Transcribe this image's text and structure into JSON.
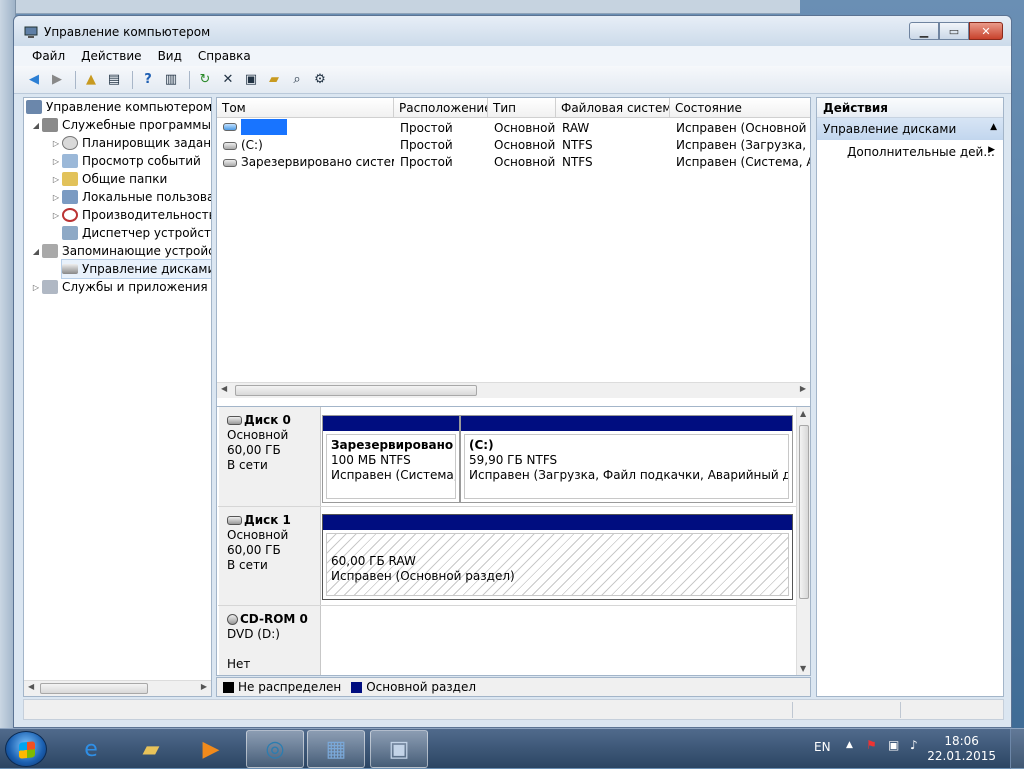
{
  "window": {
    "title": "Управление компьютером"
  },
  "menu": [
    "Файл",
    "Действие",
    "Вид",
    "Справка"
  ],
  "tree": {
    "root": "Управление компьютером (л",
    "system_tools": "Служебные программы",
    "scheduler": "Планировщик заданий",
    "events": "Просмотр событий",
    "shared": "Общие папки",
    "local_users": "Локальные пользовате",
    "performance": "Производительность",
    "devices": "Диспетчер устройств",
    "storage": "Запоминающие устройств",
    "disk_mgmt": "Управление дисками",
    "services": "Службы и приложения"
  },
  "volumes": {
    "headers": [
      "Том",
      "Расположение",
      "Тип",
      "Файловая система",
      "Состояние"
    ],
    "rows": [
      {
        "name": "",
        "layout": "Простой",
        "type": "Основной",
        "fs": "RAW",
        "status": "Исправен (Основной раз"
      },
      {
        "name": "(C:)",
        "layout": "Простой",
        "type": "Основной",
        "fs": "NTFS",
        "status": "Исправен (Загрузка, Фай"
      },
      {
        "name": "Зарезервировано системой",
        "layout": "Простой",
        "type": "Основной",
        "fs": "NTFS",
        "status": "Исправен (Система, Акти"
      }
    ]
  },
  "disks": {
    "disk0": {
      "name": "Диск 0",
      "type": "Основной",
      "size": "60,00 ГБ",
      "state": "В сети",
      "p1": {
        "title": "Зарезервировано си",
        "line2": "100 МБ NTFS",
        "line3": "Исправен (Система, А"
      },
      "p2": {
        "title": "(C:)",
        "line2": "59,90 ГБ NTFS",
        "line3": "Исправен (Загрузка, Файл подкачки, Аварийный дамп па"
      }
    },
    "disk1": {
      "name": "Диск 1",
      "type": "Основной",
      "size": "60,00 ГБ",
      "state": "В сети",
      "p1": {
        "line2": "60,00 ГБ RAW",
        "line3": "Исправен (Основной раздел)"
      }
    },
    "cdrom": {
      "name": "CD-ROM 0",
      "drive": "DVD (D:)",
      "media": "Нет носителя"
    }
  },
  "legend": {
    "unallocated": "Не распределен",
    "primary": "Основной раздел"
  },
  "actions": {
    "header": "Действия",
    "section": "Управление дисками",
    "more": "Дополнительные дей..."
  },
  "tray": {
    "lang": "EN",
    "time": "18:06",
    "date": "22.01.2015"
  },
  "colors": {
    "partition_bar": "#000d80",
    "unallocated": "#000000",
    "redacted": "#1874ff"
  }
}
